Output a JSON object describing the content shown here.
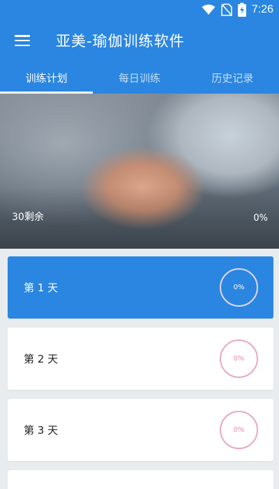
{
  "status_bar": {
    "time": "7:26",
    "icons": [
      "wifi-icon",
      "no-sim-icon",
      "battery-charging-icon"
    ]
  },
  "app": {
    "title": "亚美-瑜伽训练软件",
    "menu_icon": "menu-icon"
  },
  "tabs": [
    {
      "label": "训练计划",
      "active": true
    },
    {
      "label": "每日训练",
      "active": false
    },
    {
      "label": "历史记录",
      "active": false
    }
  ],
  "hero": {
    "remaining_text": "30剩余",
    "progress_text": "0%"
  },
  "days": [
    {
      "label": "第 1 天",
      "progress": "0%",
      "active": true
    },
    {
      "label": "第 2 天",
      "progress": "0%",
      "active": false
    },
    {
      "label": "第 3 天",
      "progress": "0%",
      "active": false
    }
  ],
  "colors": {
    "primary": "#2a86e0",
    "ring": "#e7a8c0",
    "background": "#e9ecef"
  }
}
